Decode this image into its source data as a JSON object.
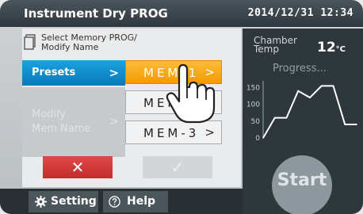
{
  "header": {
    "title": "Instrument Dry PROG",
    "datetime": "2014/12/31 12:34"
  },
  "instruction": "Select Memory PROG/\nModify Name",
  "tabs": {
    "presets": "Presets",
    "modify": "Modify\nMem Name",
    "chevron": ">"
  },
  "memories": [
    "MEM-1",
    "MEM-2",
    "MEM-3"
  ],
  "actions": {
    "cancel_icon": "✕",
    "confirm_icon": "✓"
  },
  "chamber": {
    "label": "Chamber\nTemp",
    "value": "12",
    "unit": "°C"
  },
  "progress_label": "Progress...",
  "chart_data": {
    "type": "line",
    "y_ticks": [
      "150",
      "100",
      "50",
      "0"
    ],
    "ylim": [
      0,
      170
    ],
    "x": [
      0,
      1,
      2,
      3,
      4,
      5,
      6,
      7,
      8
    ],
    "values": [
      0,
      60,
      60,
      140,
      120,
      155,
      155,
      40,
      40
    ]
  },
  "start_button": "Start",
  "footer": {
    "setting_label": "Setting",
    "help_label": "Help"
  },
  "colors": {
    "accent": "#0a78b8",
    "selected": "#f39a00",
    "danger": "#c42c2c"
  }
}
